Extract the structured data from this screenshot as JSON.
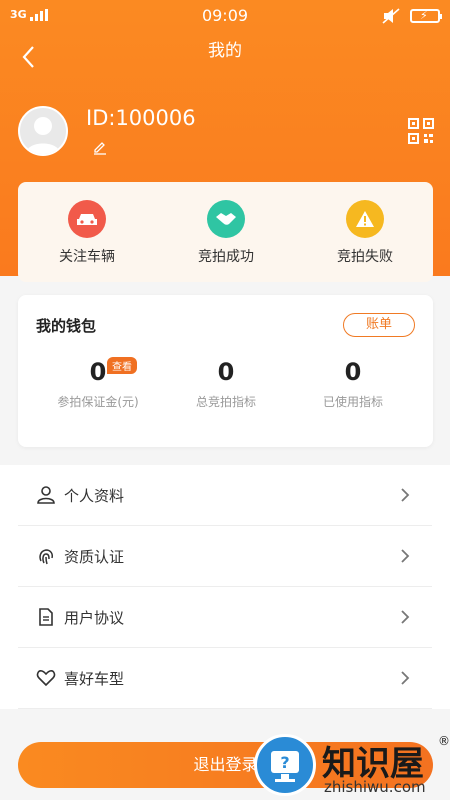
{
  "status_bar": {
    "network": "3G",
    "time": "09:09"
  },
  "nav": {
    "title": "我的"
  },
  "profile": {
    "id_text": "ID:100006"
  },
  "quick_actions": [
    {
      "label": "关注车辆",
      "icon": "car-icon",
      "color": "#f15a4a"
    },
    {
      "label": "竞拍成功",
      "icon": "handshake-icon",
      "color": "#2fc5a3"
    },
    {
      "label": "竞拍失败",
      "icon": "warning-icon",
      "color": "#f6b820"
    }
  ],
  "wallet": {
    "title": "我的钱包",
    "bill_button": "账单",
    "badge": "查看",
    "stats": [
      {
        "value": "0",
        "label": "参拍保证金(元)"
      },
      {
        "value": "0",
        "label": "总竞拍指标"
      },
      {
        "value": "0",
        "label": "已使用指标"
      }
    ]
  },
  "menu": [
    {
      "label": "个人资料",
      "icon": "person-icon"
    },
    {
      "label": "资质认证",
      "icon": "fingerprint-icon"
    },
    {
      "label": "用户协议",
      "icon": "document-icon"
    },
    {
      "label": "喜好车型",
      "icon": "heart-icon"
    }
  ],
  "logout": {
    "label": "退出登录"
  },
  "watermark": {
    "title": "知识屋",
    "subtitle": "zhishiwu.com",
    "reg": "®"
  },
  "colors": {
    "accent": "#fa7a1e",
    "background": "#f5f5f5"
  }
}
